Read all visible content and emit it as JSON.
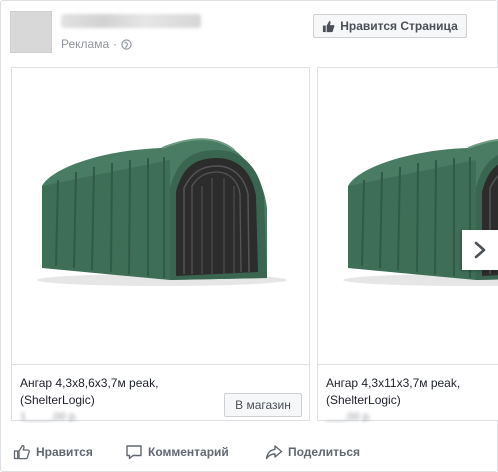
{
  "header": {
    "sponsored_label": "Реклама",
    "like_page_label": "Нравится Страница"
  },
  "carousel": {
    "cards": [
      {
        "title_line1": "Ангар 4,3x8,6x3,7м peak,",
        "title_line2": "(ShelterLogic)",
        "price": "1____,00 р.",
        "button_label": "В магазин"
      },
      {
        "title_line1": "Ангар 4,3x11x3,7м peak,",
        "title_line2": "(ShelterLogic)",
        "price": "___,00 р."
      }
    ]
  },
  "actions": {
    "like_label": "Нравится",
    "comment_label": "Комментарий",
    "share_label": "Поделиться"
  },
  "colors": {
    "link_gray": "#90949c",
    "button_text": "#4b4f56",
    "action_text": "#606770",
    "tent_green": "#3f6e57"
  },
  "icons": {
    "sponsored": "globe-icon",
    "like_page": "thumbs-up-icon",
    "next": "chevron-right-icon",
    "like": "thumbs-up-outline-icon",
    "comment": "comment-bubble-icon",
    "share": "share-arrow-icon"
  }
}
